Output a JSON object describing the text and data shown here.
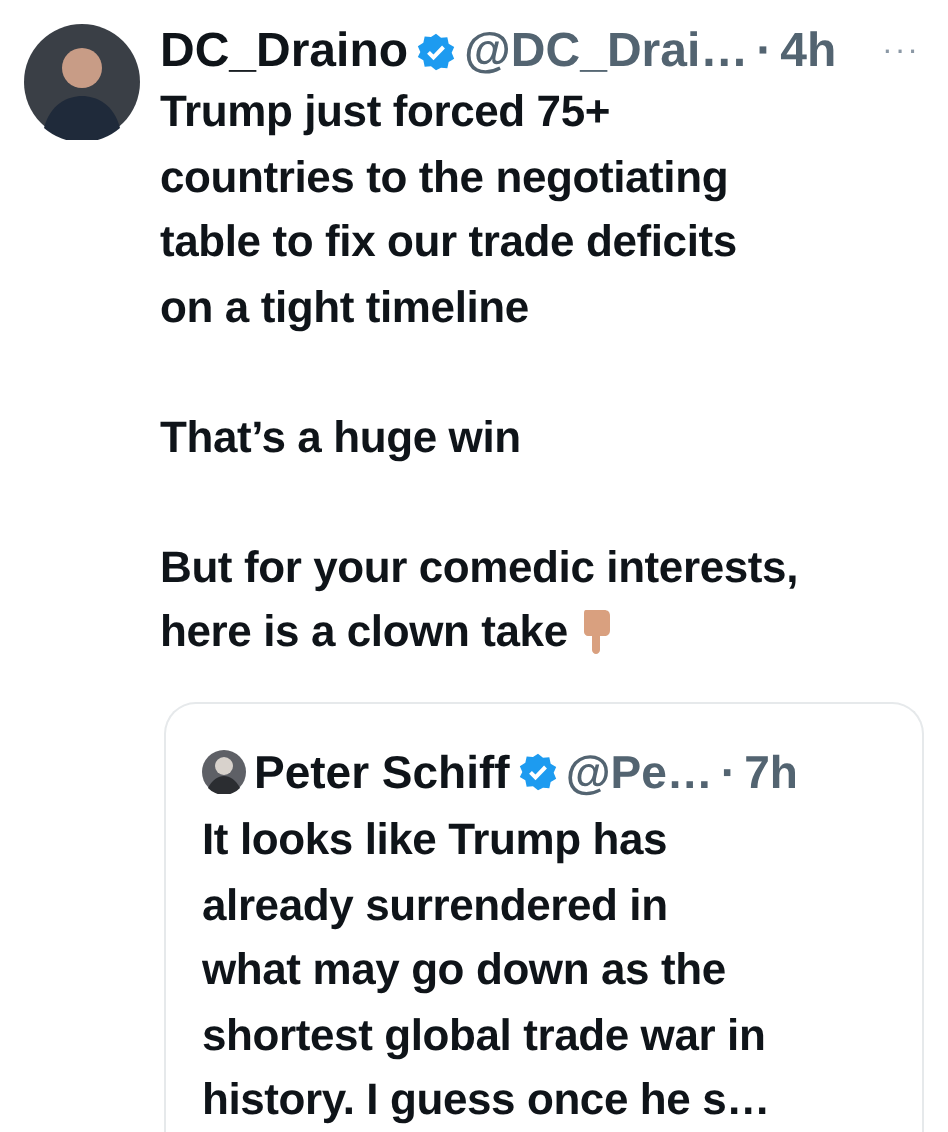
{
  "tweet": {
    "author": {
      "name": "DC_Draino",
      "verified": true,
      "handle": "@DC_Drai…",
      "separator": "·",
      "time": "4h"
    },
    "more": "···",
    "paragraphs": [
      {
        "lines": [
          "Trump just forced 75+",
          "countries to the negotiating",
          "table to fix our trade deficits",
          "on a tight timeline"
        ]
      },
      {
        "lines": [
          "That’s a huge win"
        ]
      },
      {
        "lines": [
          "But for your comedic interests,",
          "here is a clown take"
        ]
      }
    ],
    "quote": {
      "author": {
        "name": "Peter Schiff",
        "verified": true,
        "handle": "@Pe…",
        "separator": "·",
        "time": "7h"
      },
      "lines": [
        "It looks like Trump has",
        "already surrendered in",
        "what may go down as the",
        "shortest global trade war in",
        "history.  I guess once he s…"
      ]
    }
  }
}
